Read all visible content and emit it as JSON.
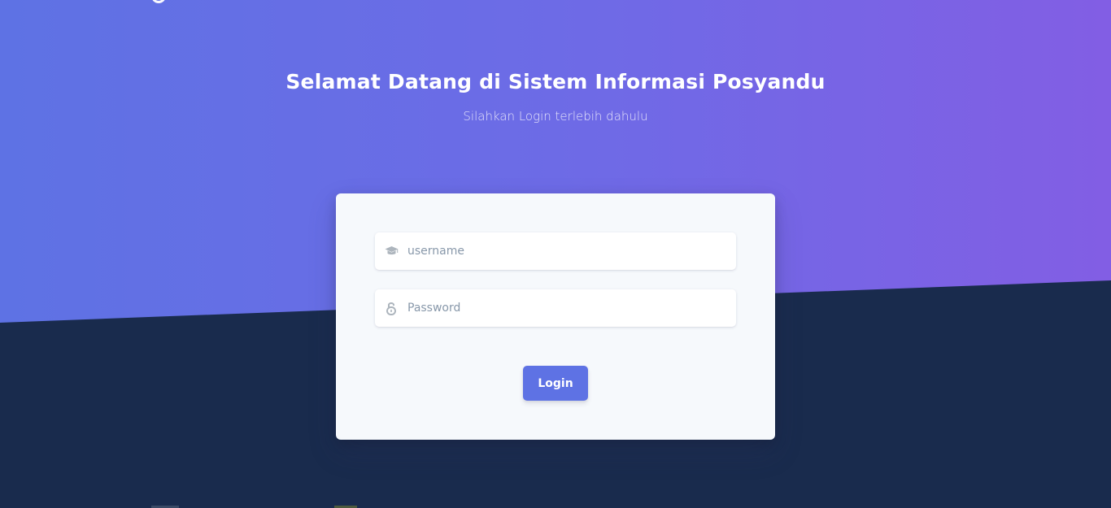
{
  "hero": {
    "title": "Selamat Datang di Sistem Informasi Posyandu",
    "subtitle": "Silahkan Login terlebih dahulu"
  },
  "login_form": {
    "username": {
      "placeholder": "username",
      "value": "",
      "icon": "graduation-cap-icon"
    },
    "password": {
      "placeholder": "Password",
      "value": "",
      "icon": "unlock-icon"
    },
    "submit_label": "Login"
  },
  "colors": {
    "gradient_start": "#5e72e4",
    "gradient_end": "#825ee4",
    "background_dark": "#192b4d",
    "card_background": "#f6f9fc",
    "primary_button": "#5e72e4",
    "icon_gray": "#adb5bd"
  }
}
